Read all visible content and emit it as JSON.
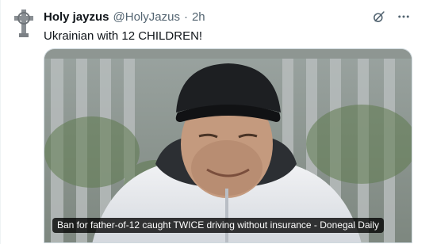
{
  "tweet": {
    "display_name": "Holy jayzus",
    "handle": "@HolyJazus",
    "separator": "·",
    "time": "2h",
    "text": "Ukrainian with 12 CHILDREN!",
    "avatar_icon": "celtic-cross-icon",
    "actions": {
      "grok_icon": "grok-icon",
      "more_icon": "more-options-icon"
    }
  },
  "media": {
    "card_caption": "Ban for father-of-12 caught TWICE driving without insurance - Donegal Daily"
  },
  "colors": {
    "text_primary": "#0f1419",
    "text_secondary": "#536471",
    "border": "#cfd9de"
  }
}
